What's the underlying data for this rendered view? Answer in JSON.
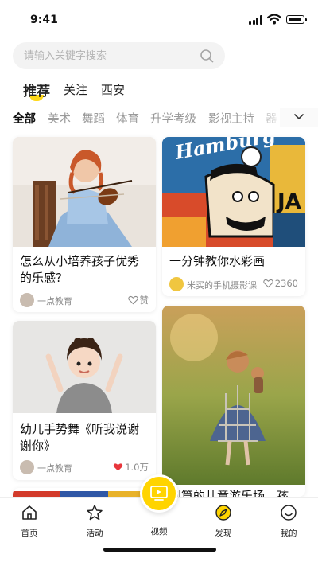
{
  "status": {
    "time": "9:41"
  },
  "search": {
    "placeholder": "请输入关键字搜索"
  },
  "tabs": [
    {
      "label": "推荐",
      "active": true
    },
    {
      "label": "关注",
      "active": false
    },
    {
      "label": "西安",
      "active": false
    }
  ],
  "categories": [
    {
      "label": "全部",
      "active": true
    },
    {
      "label": "美术"
    },
    {
      "label": "舞蹈"
    },
    {
      "label": "体育"
    },
    {
      "label": "升学考级"
    },
    {
      "label": "影视主持"
    },
    {
      "label": "器"
    }
  ],
  "cards": [
    {
      "title": "怎么从小培养孩子优秀的乐感?",
      "author": "一点教育",
      "like_label": "赞",
      "liked": false
    },
    {
      "title": "一分钟教你水彩画",
      "author": "米买的手机摄影课",
      "like_label": "2360",
      "liked": false
    },
    {
      "title": "幼儿手势舞《听我说谢谢你》",
      "author": "一点教育",
      "like_label": "1.0万",
      "liked": true
    },
    {
      "title": "划算的儿童游乐场，孩",
      "author": "",
      "like_label": "",
      "liked": false
    }
  ],
  "tabbar": {
    "items": [
      {
        "label": "首页",
        "icon": "home-icon"
      },
      {
        "label": "活动",
        "icon": "star-icon"
      },
      {
        "label": "视频",
        "icon": "tv-icon"
      },
      {
        "label": "发现",
        "icon": "compass-icon"
      },
      {
        "label": "我的",
        "icon": "smile-icon"
      }
    ]
  },
  "colors": {
    "accent": "#ffd400",
    "like_active": "#e8363c"
  }
}
